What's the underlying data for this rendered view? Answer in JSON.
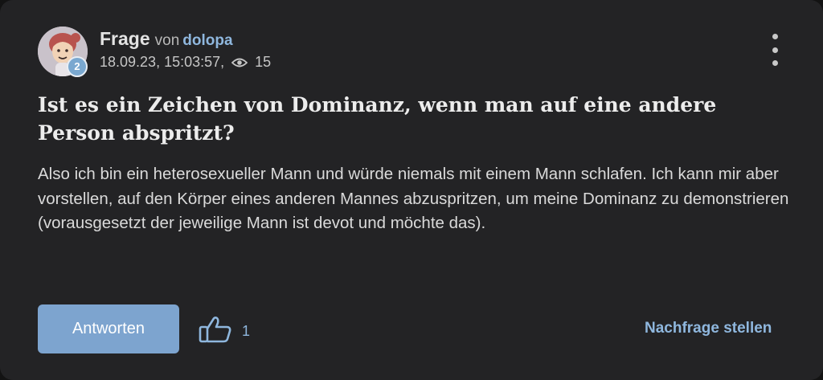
{
  "post": {
    "type_label": "Frage",
    "by_label": "von",
    "author": "dolopa",
    "author_level": "2",
    "timestamp": "18.09.23, 15:03:57,",
    "views": "15",
    "title": "Ist es ein Zeichen von Dominanz, wenn man auf eine andere Person abspritzt?",
    "body": "Also ich bin ein heterosexueller Mann und würde niemals mit einem Mann schlafen. Ich kann mir aber vorstellen, auf den Körper eines anderen Mannes abzuspritzen, um meine Dominanz zu demonstrieren (vorausgesetzt der jeweilige Mann ist devot und möchte das)."
  },
  "actions": {
    "answer_label": "Antworten",
    "like_count": "1",
    "follow_up_label": "Nachfrage stellen"
  },
  "icons": {
    "views": "eye-icon",
    "like": "thumbs-up-icon",
    "menu": "more-vertical-icon"
  },
  "colors": {
    "background": "#232325",
    "accent": "#8fb7de",
    "button": "#7da4cf"
  }
}
